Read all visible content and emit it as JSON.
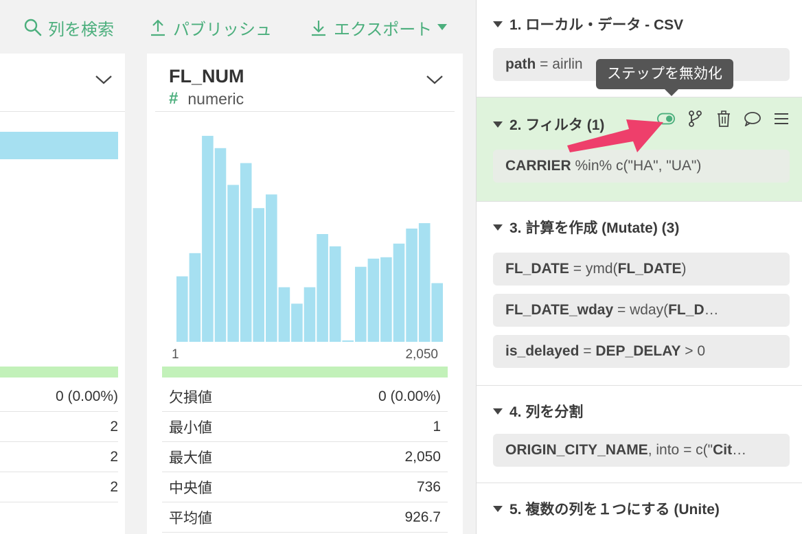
{
  "toolbar": {
    "search_label": "列を検索",
    "publish_label": "パブリッシュ",
    "export_label": "エクスポート"
  },
  "left_column": {
    "stats": [
      "0 (0.00%)",
      "2",
      "2",
      "2"
    ]
  },
  "column": {
    "name": "FL_NUM",
    "type_symbol": "#",
    "type": "numeric",
    "axis_min": "1",
    "axis_max": "2,050",
    "histogram_values": [
      96,
      130,
      302,
      284,
      230,
      262,
      196,
      216,
      80,
      56,
      80,
      158,
      140,
      2,
      110,
      122,
      124,
      144,
      166,
      174,
      86
    ],
    "stats": [
      {
        "label": "欠損値",
        "value": "0 (0.00%)"
      },
      {
        "label": "最小値",
        "value": "1"
      },
      {
        "label": "最大値",
        "value": "2,050"
      },
      {
        "label": "中央値",
        "value": "736"
      },
      {
        "label": "平均値",
        "value": "926.7"
      }
    ]
  },
  "steps": [
    {
      "title": "1. ローカル・データ - CSV",
      "cmd_key": "path",
      "cmd_rest": " = airlin"
    },
    {
      "title": "2. フィルタ (1)",
      "cmd_key": "CARRIER",
      "cmd_rest": " %in% c(\"HA\", \"UA\")"
    },
    {
      "title": "3. 計算を作成 (Mutate) (3)",
      "cmds": [
        {
          "key": "FL_DATE",
          "mid": " = ymd(",
          "b2": "FL_DATE",
          "end": ")"
        },
        {
          "key": "FL_DATE_wday",
          "mid": " = wday(",
          "b2": "FL_D",
          "end": "…"
        },
        {
          "key": "is_delayed",
          "mid": " = ",
          "b2": "DEP_DELAY",
          "end": " > 0"
        }
      ]
    },
    {
      "title": "4. 列を分割",
      "cmd_key": "ORIGIN_CITY_NAME",
      "cmd_mid": ", into = c(\"",
      "cmd_b2": "Cit",
      "cmd_end": "…"
    },
    {
      "title": "5. 複数の列を１つにする (Unite)"
    }
  ],
  "tooltip": "ステップを無効化",
  "colors": {
    "accent": "#4caf7d",
    "bar": "#a6e0f1",
    "valid": "#c2f1b9",
    "active_step": "#dff3dc",
    "arrow": "#ee3f6b"
  }
}
